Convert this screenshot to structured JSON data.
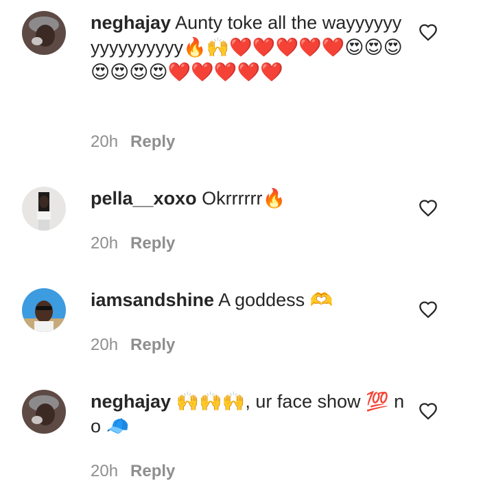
{
  "comments": [
    {
      "username": "neghajay",
      "text": "Aunty toke all the wayyyyyyyyyyyyyyyy🔥🙌❤️❤️❤️❤️❤️😍😍😍😍😍😍😍❤️❤️❤️❤️❤️",
      "time": "20h",
      "reply_label": "Reply"
    },
    {
      "username": "pella__xoxo",
      "text": "Okrrrrrr🔥",
      "time": "20h",
      "reply_label": "Reply"
    },
    {
      "username": "iamsandshine",
      "text": "A goddess 🫶",
      "time": "20h",
      "reply_label": "Reply"
    },
    {
      "username": "neghajay",
      "text": "🙌🙌🙌, ur face show 💯 no 🧢",
      "time": "20h",
      "reply_label": "Reply"
    }
  ],
  "colors": {
    "text": "#262626",
    "meta": "#8e8e8e",
    "background": "#ffffff"
  },
  "icons": {
    "like": "heart-outline-icon"
  }
}
